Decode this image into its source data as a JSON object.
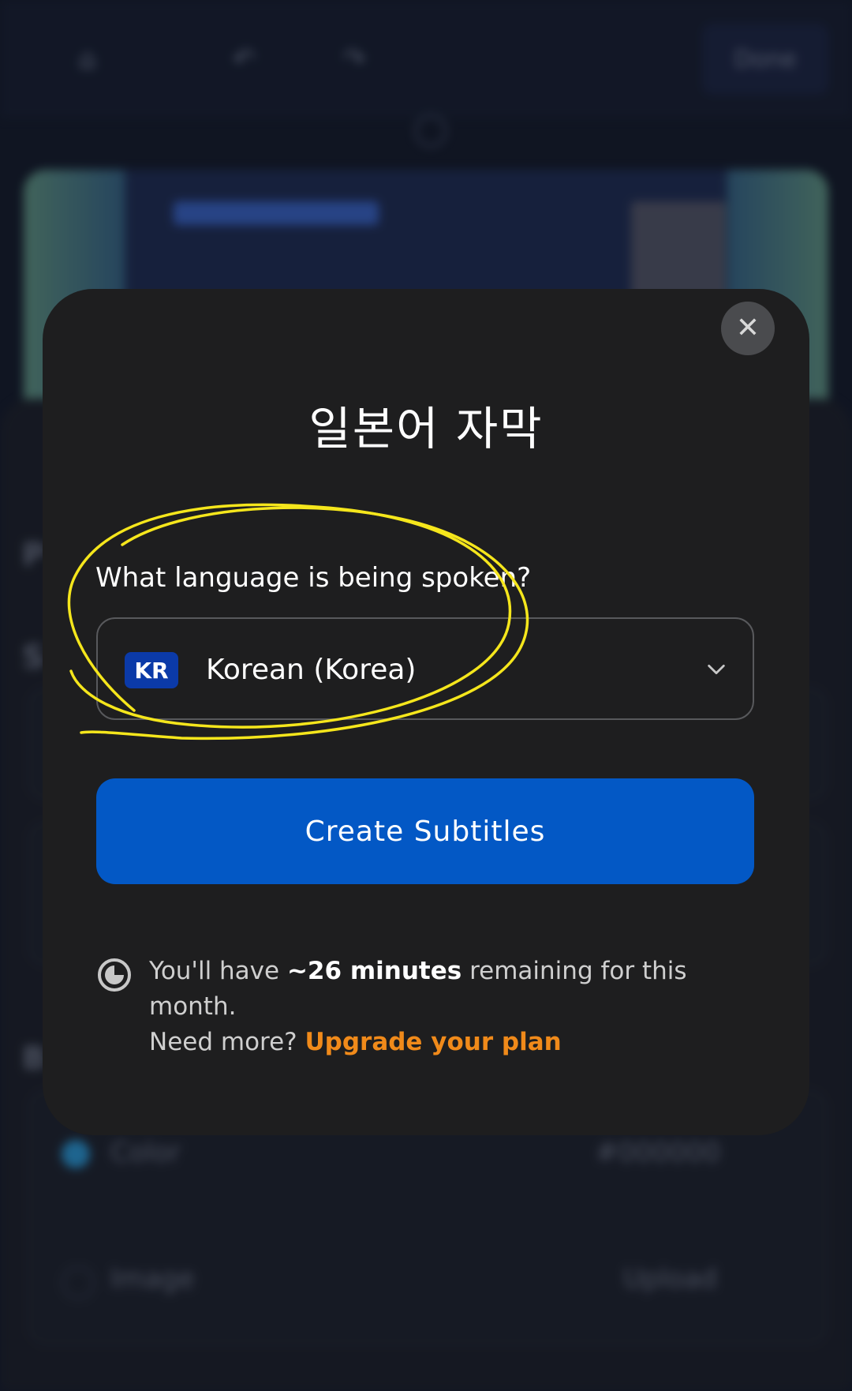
{
  "background": {
    "done_label": "Done",
    "section_labels": [
      "P",
      "S",
      "B"
    ],
    "rows": [
      {
        "label": "Color",
        "value": "#000000"
      },
      {
        "label": "Image",
        "value": "Upload"
      }
    ]
  },
  "modal": {
    "title": "일본어 자막",
    "close_icon": "close-icon",
    "question": "What language is being spoken?",
    "language": {
      "flag_code": "KR",
      "label": "Korean (Korea)"
    },
    "create_button": "Create Subtitles",
    "usage": {
      "prefix": "You'll have ",
      "amount": "~26 minutes",
      "suffix": " remaining for this month.",
      "need_more": "Need more? ",
      "upgrade_link": "Upgrade your plan"
    }
  },
  "colors": {
    "accent": "#0358c5",
    "link": "#f08a1a",
    "modal_bg": "#1e1e1f",
    "annotation": "#f5e61c"
  }
}
